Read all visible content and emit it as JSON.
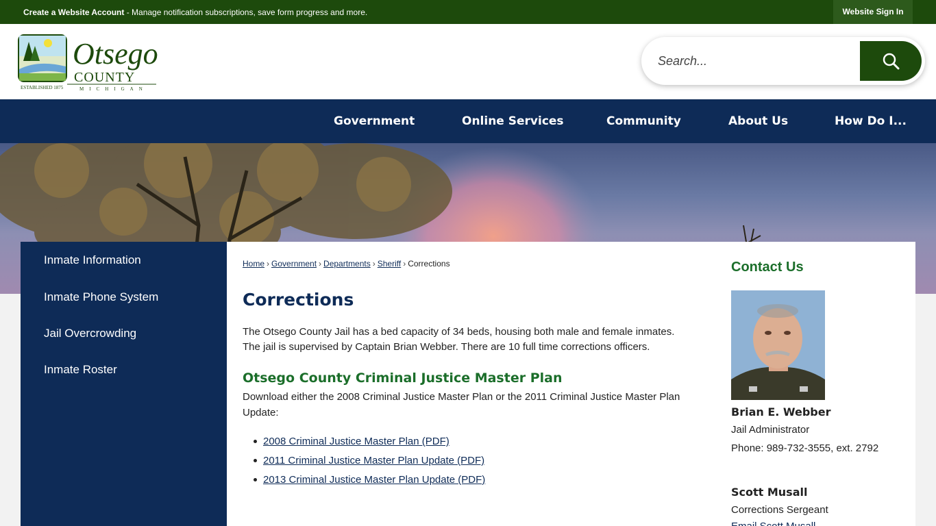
{
  "topbar": {
    "message_bold": "Create a Website Account",
    "message_rest": " - Manage notification subscriptions, save form progress and more.",
    "signin_label": "Website Sign In"
  },
  "logo": {
    "name": "Otsego",
    "county": "COUNTY",
    "state": "MICHIGAN",
    "established": "ESTABLISHED 1875"
  },
  "search": {
    "placeholder": "Search..."
  },
  "nav": {
    "items": [
      "Government",
      "Online Services",
      "Community",
      "About Us",
      "How Do I..."
    ]
  },
  "sidebar": {
    "items": [
      "Inmate Information",
      "Inmate Phone System",
      "Jail Overcrowding",
      "Inmate Roster"
    ]
  },
  "breadcrumb": {
    "items": [
      "Home",
      "Government",
      "Departments",
      "Sheriff"
    ],
    "current": "Corrections",
    "separator": "›"
  },
  "main": {
    "title": "Corrections",
    "intro": "The Otsego County Jail has a bed capacity of 34 beds, housing both male and female inmates. The jail is supervised by Captain Brian Webber. There are 10 full time corrections officers.",
    "subtitle": "Otsego County Criminal Justice Master Plan",
    "description": "Download either the 2008 Criminal Justice Master Plan or the 2011 Criminal Justice Master Plan Update:",
    "documents": [
      "2008 Criminal Justice Master Plan (PDF)",
      "2011 Criminal Justice Master Plan Update (PDF)",
      "2013 Criminal Justice Master Plan Update (PDF)"
    ]
  },
  "contact": {
    "title": "Contact Us",
    "people": [
      {
        "name": "Brian E. Webber",
        "role": "Jail Administrator",
        "phone": "Phone: 989-732-3555, ext. 2792"
      },
      {
        "name": "Scott Musall",
        "role": "Corrections Sergeant",
        "email": "Email Scott Musall"
      }
    ]
  },
  "colors": {
    "topbar_green": "#1d4a0c",
    "navy": "#0e2b57",
    "heading_green": "#1b6e2a"
  }
}
